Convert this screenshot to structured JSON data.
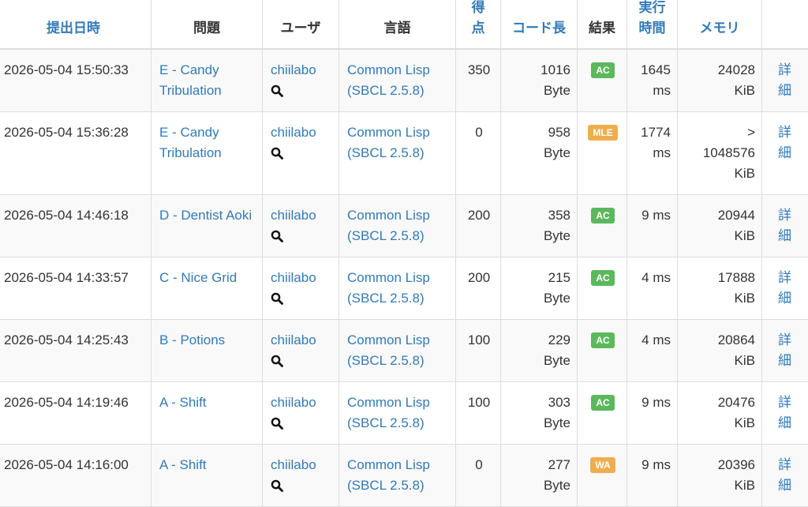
{
  "table": {
    "headers": {
      "date": "提出日時",
      "task": "問題",
      "user": "ユーザ",
      "language": "言語",
      "score_line1": "得",
      "score_line2": "点",
      "code_length": "コード長",
      "result": "結果",
      "time_line1": "実行",
      "time_line2": "時間",
      "memory": "メモリ"
    },
    "rows": [
      {
        "date": "2026-05-04 15:50:33",
        "task": "E - Candy Tribulation",
        "user": "chiilabo",
        "language": "Common Lisp (SBCL 2.5.8)",
        "score": "350",
        "length_value": "1016",
        "length_unit": "Byte",
        "result": "AC",
        "time_value": "1645",
        "time_unit": "ms",
        "memory_prefix": "",
        "memory_value": "24028",
        "memory_unit": "KiB",
        "detail_line1": "詳",
        "detail_line2": "細"
      },
      {
        "date": "2026-05-04 15:36:28",
        "task": "E - Candy Tribulation",
        "user": "chiilabo",
        "language": "Common Lisp (SBCL 2.5.8)",
        "score": "0",
        "length_value": "958",
        "length_unit": "Byte",
        "result": "MLE",
        "time_value": "1774",
        "time_unit": "ms",
        "memory_prefix": ">",
        "memory_value": "1048576",
        "memory_unit": "KiB",
        "detail_line1": "詳",
        "detail_line2": "細"
      },
      {
        "date": "2026-05-04 14:46:18",
        "task": "D - Dentist Aoki",
        "user": "chiilabo",
        "language": "Common Lisp (SBCL 2.5.8)",
        "score": "200",
        "length_value": "358",
        "length_unit": "Byte",
        "result": "AC",
        "time_value": "9 ms",
        "time_unit": "",
        "memory_prefix": "",
        "memory_value": "20944",
        "memory_unit": "KiB",
        "detail_line1": "詳",
        "detail_line2": "細"
      },
      {
        "date": "2026-05-04 14:33:57",
        "task": "C - Nice Grid",
        "user": "chiilabo",
        "language": "Common Lisp (SBCL 2.5.8)",
        "score": "200",
        "length_value": "215",
        "length_unit": "Byte",
        "result": "AC",
        "time_value": "4 ms",
        "time_unit": "",
        "memory_prefix": "",
        "memory_value": "17888",
        "memory_unit": "KiB",
        "detail_line1": "詳",
        "detail_line2": "細"
      },
      {
        "date": "2026-05-04 14:25:43",
        "task": "B - Potions",
        "user": "chiilabo",
        "language": "Common Lisp (SBCL 2.5.8)",
        "score": "100",
        "length_value": "229",
        "length_unit": "Byte",
        "result": "AC",
        "time_value": "4 ms",
        "time_unit": "",
        "memory_prefix": "",
        "memory_value": "20864",
        "memory_unit": "KiB",
        "detail_line1": "詳",
        "detail_line2": "細"
      },
      {
        "date": "2026-05-04 14:19:46",
        "task": "A - Shift",
        "user": "chiilabo",
        "language": "Common Lisp (SBCL 2.5.8)",
        "score": "100",
        "length_value": "303",
        "length_unit": "Byte",
        "result": "AC",
        "time_value": "9 ms",
        "time_unit": "",
        "memory_prefix": "",
        "memory_value": "20476",
        "memory_unit": "KiB",
        "detail_line1": "詳",
        "detail_line2": "細"
      },
      {
        "date": "2026-05-04 14:16:00",
        "task": "A - Shift",
        "user": "chiilabo",
        "language": "Common Lisp (SBCL 2.5.8)",
        "score": "0",
        "length_value": "277",
        "length_unit": "Byte",
        "result": "WA",
        "time_value": "9 ms",
        "time_unit": "",
        "memory_prefix": "",
        "memory_value": "20396",
        "memory_unit": "KiB",
        "detail_line1": "詳",
        "detail_line2": "細"
      }
    ]
  },
  "colors": {
    "link": "#337ab7",
    "ac": "#5cb85c",
    "warning": "#f0ad4e",
    "stripe": "#f9f9f9",
    "border": "#dddddd"
  },
  "icons": {
    "user_search": "search-icon"
  }
}
